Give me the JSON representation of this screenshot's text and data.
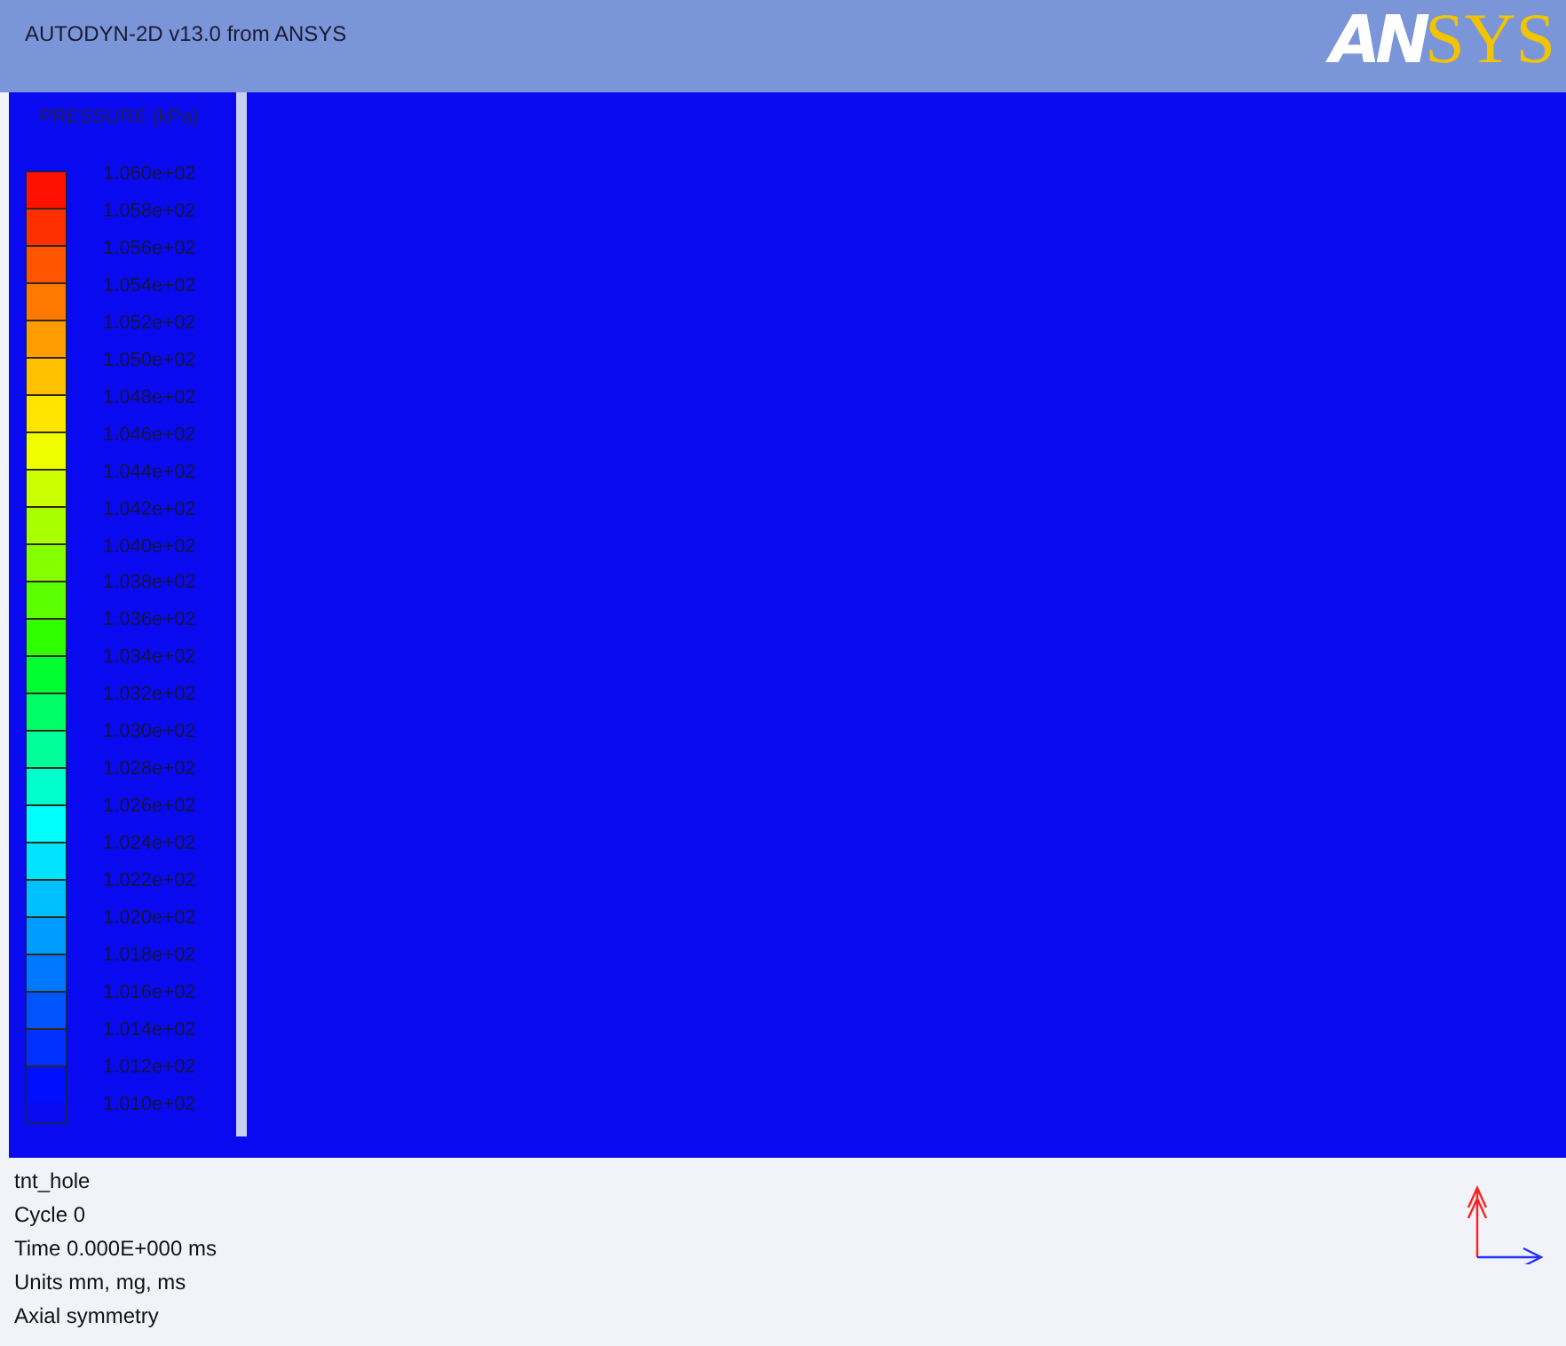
{
  "window": {
    "title": "AUTODYN-2D v13.0 from ANSYS"
  },
  "logo_parts": [
    "AN",
    "SYS"
  ],
  "legend": {
    "title": "PRESSURE (kPa)",
    "levels": [
      "1.060e+02",
      "1.058e+02",
      "1.056e+02",
      "1.054e+02",
      "1.052e+02",
      "1.050e+02",
      "1.048e+02",
      "1.046e+02",
      "1.044e+02",
      "1.042e+02",
      "1.040e+02",
      "1.038e+02",
      "1.036e+02",
      "1.034e+02",
      "1.032e+02",
      "1.030e+02",
      "1.028e+02",
      "1.026e+02",
      "1.024e+02",
      "1.022e+02",
      "1.020e+02",
      "1.018e+02",
      "1.016e+02",
      "1.014e+02",
      "1.012e+02",
      "1.010e+02"
    ],
    "swatches": [
      {
        "color": "#ff1000"
      },
      {
        "color": "#ff3000"
      },
      {
        "color": "#ff5500"
      },
      {
        "color": "#ff7800"
      },
      {
        "color": "#ff9c00"
      },
      {
        "color": "#ffc000"
      },
      {
        "color": "#ffe400"
      },
      {
        "color": "#f0ff00"
      },
      {
        "color": "#ccff00"
      },
      {
        "color": "#a8ff00"
      },
      {
        "color": "#84ff00"
      },
      {
        "color": "#5cff00"
      },
      {
        "color": "#30ff00"
      },
      {
        "color": "#00ff30"
      },
      {
        "color": "#00ff66"
      },
      {
        "color": "#00ff99"
      },
      {
        "color": "#00ffcc"
      },
      {
        "color": "#00ffff"
      },
      {
        "color": "#00e4ff"
      },
      {
        "color": "#00c0ff"
      },
      {
        "color": "#009cff"
      },
      {
        "color": "#0078ff"
      },
      {
        "color": "#0054ff"
      },
      {
        "color": "#0030ff"
      },
      {
        "color": "#0010ff"
      }
    ]
  },
  "info_lines": [
    "tnt_hole",
    "Cycle 0",
    "Time 0.000E+000 ms",
    "Units mm, mg, ms",
    "Axial symmetry"
  ]
}
